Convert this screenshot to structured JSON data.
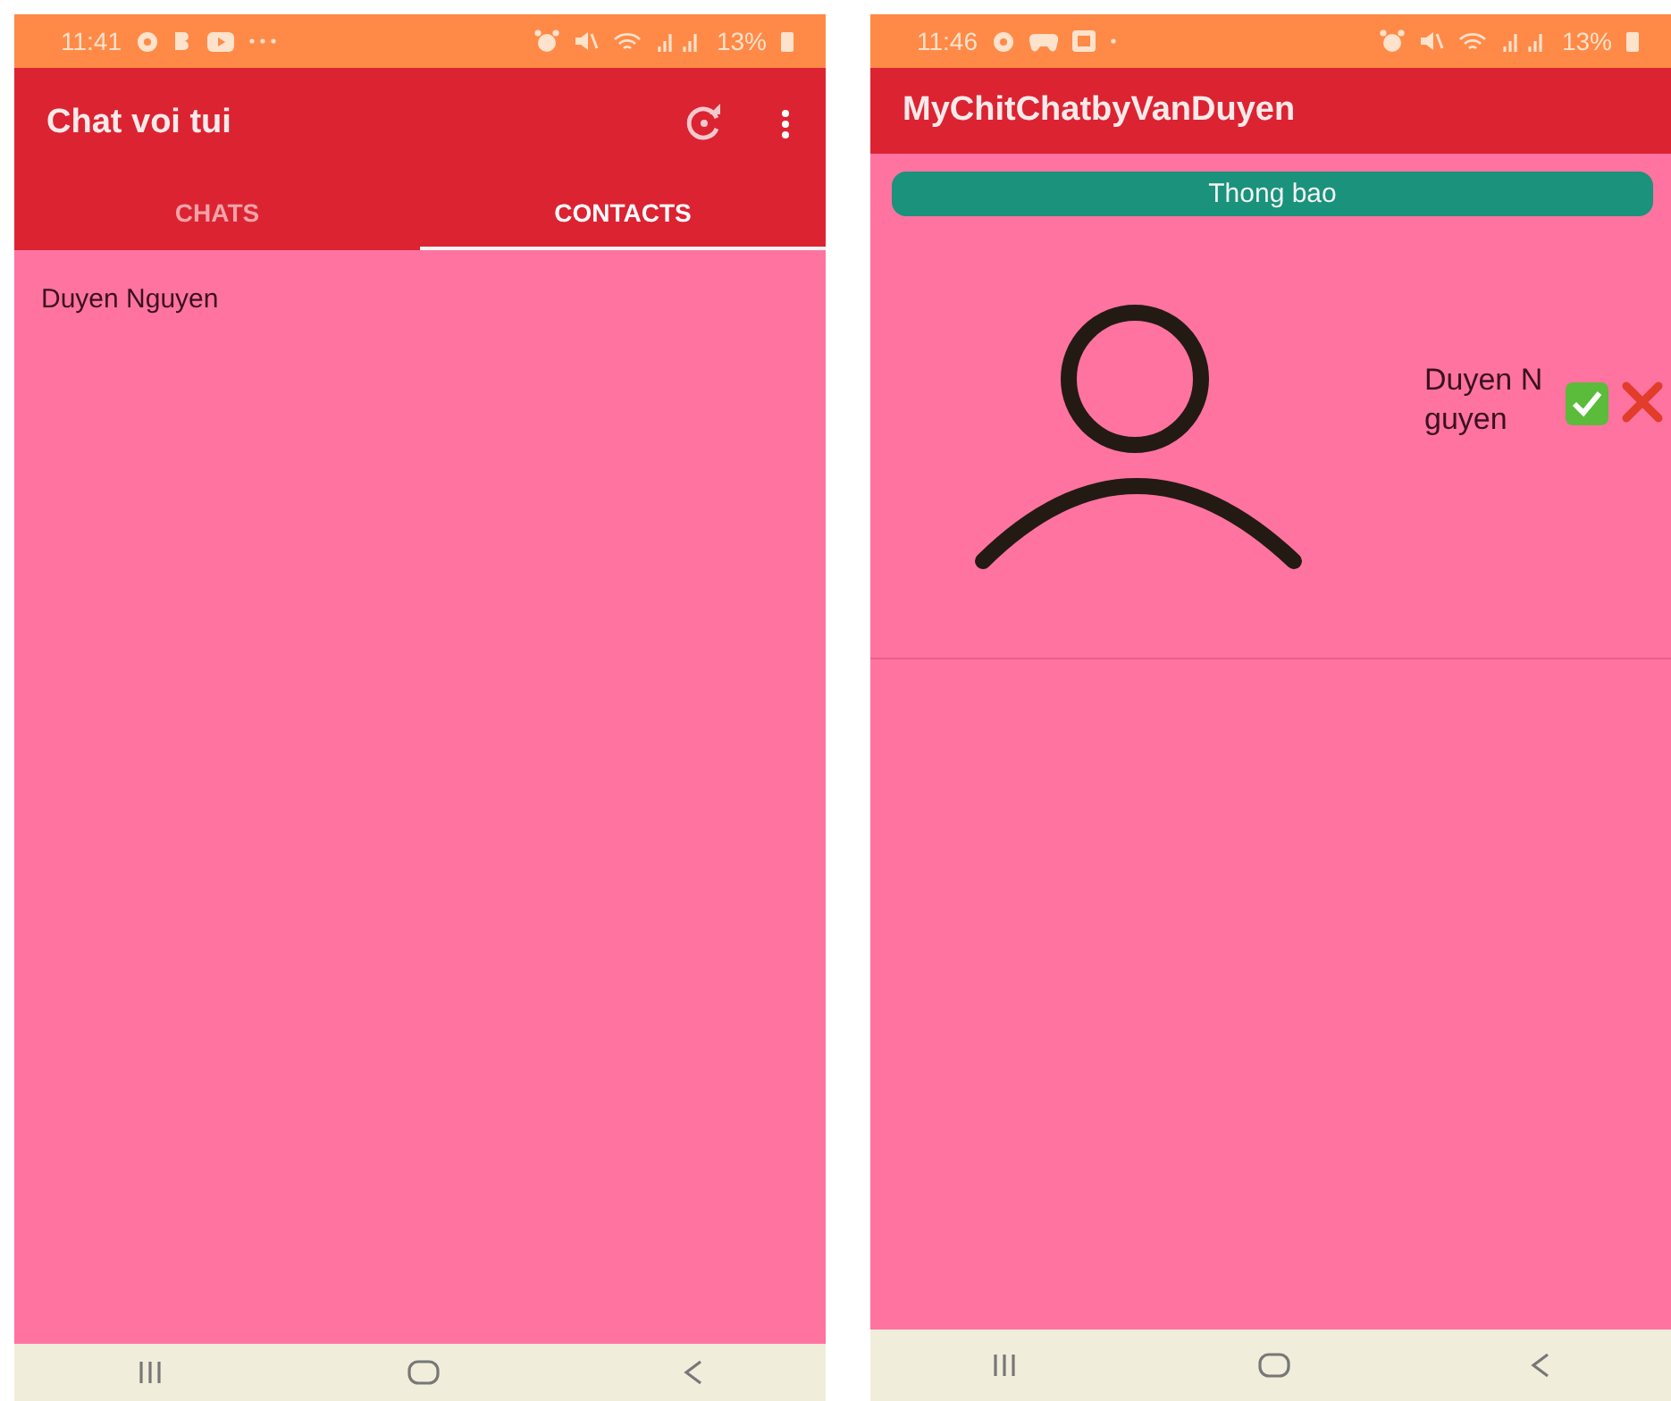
{
  "screens": [
    {
      "status_bar": {
        "time": "11:41",
        "battery": "13%"
      },
      "app_bar": {
        "title": "Chat voi tui"
      },
      "tabs": [
        {
          "label": "CHATS",
          "selected": false
        },
        {
          "label": "CONTACTS",
          "selected": true
        }
      ],
      "contacts": [
        {
          "name": "Duyen Nguyen"
        }
      ]
    },
    {
      "status_bar": {
        "time": "11:46",
        "battery": "13%"
      },
      "app_bar": {
        "title": "MyChitChatbyVanDuyen"
      },
      "notify_button": {
        "label": "Thong bao"
      },
      "requests": [
        {
          "name": "Duyen Nguyen"
        }
      ]
    }
  ]
}
